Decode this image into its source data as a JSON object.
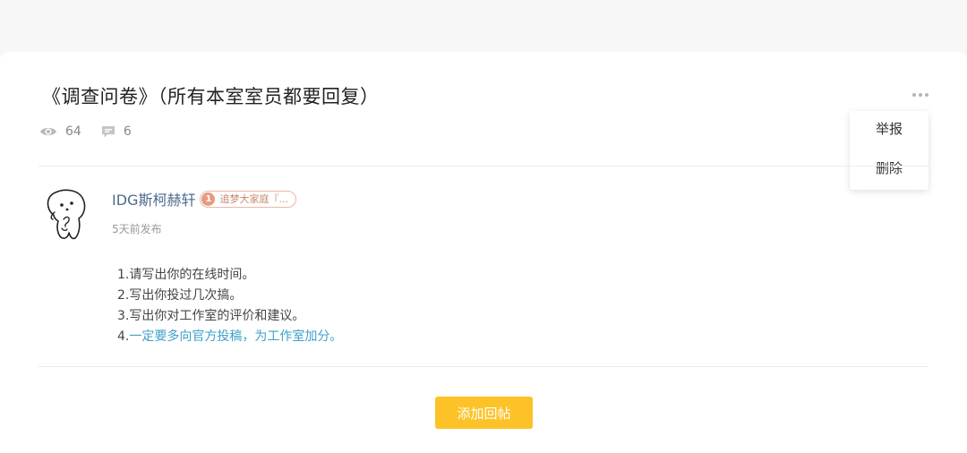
{
  "post": {
    "title": "《调查问卷》（所有本室室员都要回复）",
    "views": "64",
    "comments": "6"
  },
  "menu": {
    "items": [
      {
        "label": "举报"
      },
      {
        "label": "删除"
      }
    ]
  },
  "author": {
    "name": "IDG斯柯赫轩",
    "badge_level": "1",
    "badge_text": "追梦大家庭『...",
    "posted_time": "5天前发布"
  },
  "content": {
    "lines": [
      {
        "num": "1.",
        "text": "请写出你的在线时间。"
      },
      {
        "num": "2.",
        "text": "写出你投过几次搞。"
      },
      {
        "num": "3.",
        "text": "写出你对工作室的评价和建议。"
      },
      {
        "num": "4.",
        "text": "一定要多向官方投稿，为工作室加分。"
      }
    ]
  },
  "actions": {
    "add_reply": "添加回帖"
  },
  "colors": {
    "accent_button": "#fcc228",
    "link": "#3ea0cb",
    "author_name": "#4d6a8c",
    "badge": "#e79a7f"
  },
  "icons": {
    "views": "eye-icon",
    "comments": "comment-icon",
    "more": "more-dots-icon"
  }
}
